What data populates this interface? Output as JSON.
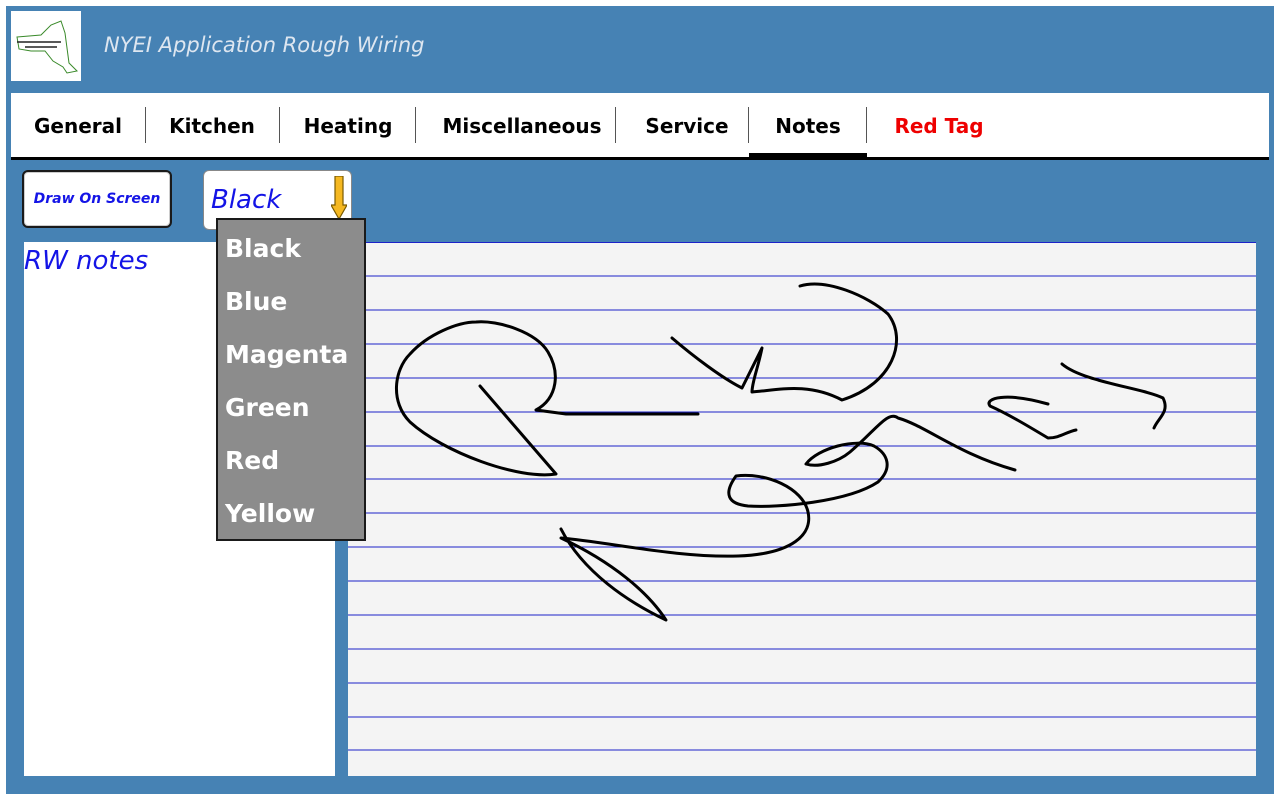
{
  "header": {
    "app_title": "NYEI Application Rough Wiring",
    "logo_icon": "ny-state-map-logo"
  },
  "tabs": [
    {
      "label": "General",
      "active": false
    },
    {
      "label": "Kitchen",
      "active": false
    },
    {
      "label": "Heating",
      "active": false
    },
    {
      "label": "Miscellaneous",
      "active": false
    },
    {
      "label": "Service",
      "active": false
    },
    {
      "label": "Notes",
      "active": true
    },
    {
      "label": "Red Tag",
      "active": false,
      "color": "#ee0000"
    }
  ],
  "toolbar": {
    "draw_button_label": "Draw On Screen",
    "color_select": {
      "value": "Black",
      "icon": "yellow-down-arrow-icon",
      "expanded": true,
      "options": [
        "Black",
        "Blue",
        "Magenta",
        "Green",
        "Red",
        "Yellow"
      ]
    }
  },
  "notes": {
    "title": "RW notes"
  },
  "drawing": {
    "background": "#f4f4f4",
    "rule_line_color": "#1c22c8",
    "ink_color": "#000000",
    "content": "handwritten sketch"
  },
  "colors": {
    "frame": "#4682b4",
    "accent_text": "#1414e6",
    "dropdown_bg": "#8c8c8c",
    "red_tag": "#ee0000"
  }
}
